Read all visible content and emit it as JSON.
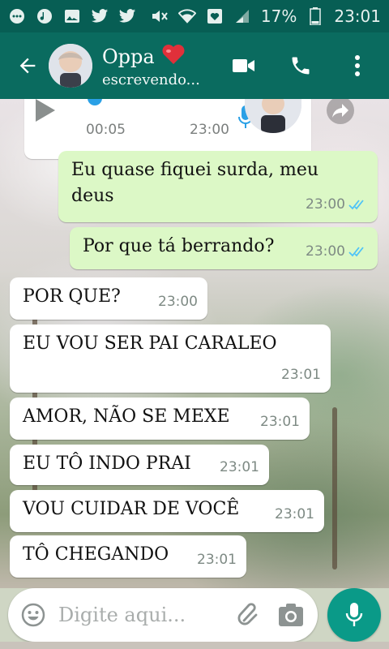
{
  "status_bar": {
    "battery": "17%",
    "time": "23:01",
    "icons": [
      "chat-icon",
      "music-icon",
      "image-icon",
      "twitter-icon",
      "twitter-icon",
      "mute-icon",
      "wifi-icon",
      "heart-icon",
      "signal-icon",
      "battery-icon"
    ]
  },
  "header": {
    "contact_name": "Oppa",
    "contact_emoji": "❤️",
    "contact_status": "escrevendo...",
    "icons": [
      "back-arrow-icon",
      "video-call-icon",
      "phone-icon",
      "more-vert-icon"
    ]
  },
  "voice_message": {
    "duration": "00:05",
    "time": "23:00"
  },
  "messages": [
    {
      "text_lines": [
        "Eu quase fiquei surda, meu",
        "deus"
      ],
      "time": "23:00",
      "direction": "out",
      "read": true
    },
    {
      "text": "Por que tá berrando?",
      "time": "23:00",
      "direction": "out",
      "read": true
    },
    {
      "text": "POR QUE?",
      "time": "23:00",
      "direction": "in"
    },
    {
      "text": "EU VOU SER PAI CARALEO",
      "time": "23:01",
      "direction": "in"
    },
    {
      "text": "AMOR, NÃO SE MEXE",
      "time": "23:01",
      "direction": "in"
    },
    {
      "text": "EU TÔ INDO PRAI",
      "time": "23:01",
      "direction": "in"
    },
    {
      "text": "VOU CUIDAR DE VOCÊ",
      "time": "23:01",
      "direction": "in"
    },
    {
      "text": "TÔ CHEGANDO",
      "time": "23:01",
      "direction": "in"
    }
  ],
  "composer": {
    "placeholder": "Digite aqui..."
  },
  "colors": {
    "header": "#075e54",
    "outgoing_bubble": "#dcf8c6",
    "incoming_bubble": "#ffffff",
    "read_ticks": "#4fc3f7",
    "mic_button": "#0a9a88"
  }
}
